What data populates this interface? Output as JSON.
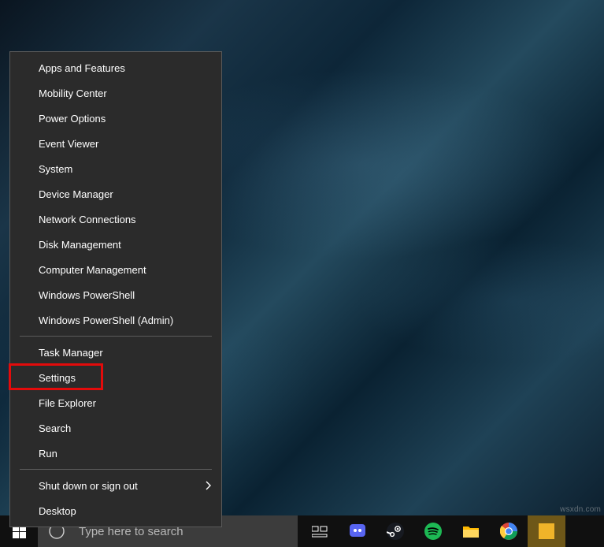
{
  "context_menu": {
    "groups": [
      [
        "Apps and Features",
        "Mobility Center",
        "Power Options",
        "Event Viewer",
        "System",
        "Device Manager",
        "Network Connections",
        "Disk Management",
        "Computer Management",
        "Windows PowerShell",
        "Windows PowerShell (Admin)"
      ],
      [
        "Task Manager",
        "Settings",
        "File Explorer",
        "Search",
        "Run"
      ],
      [
        "Shut down or sign out",
        "Desktop"
      ]
    ],
    "submenu_items": [
      "Shut down or sign out"
    ],
    "highlighted_item": "Settings"
  },
  "taskbar": {
    "search_placeholder": "Type here to search"
  },
  "watermark": "wsxdn.com"
}
